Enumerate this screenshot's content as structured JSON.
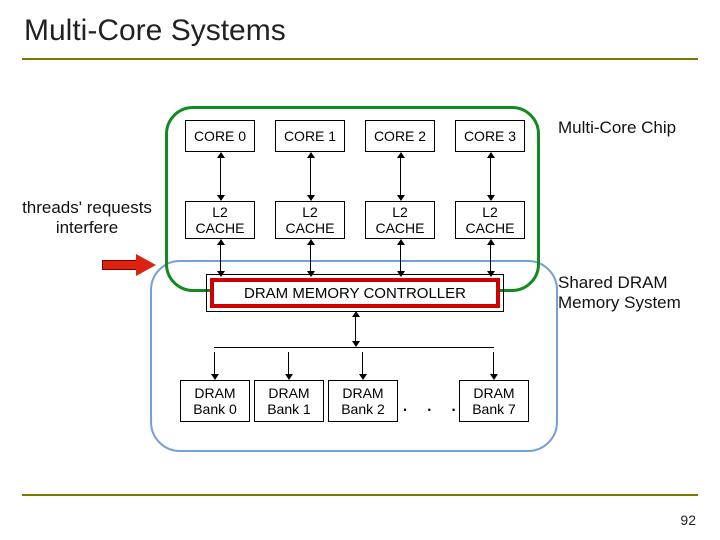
{
  "title": "Multi-Core Systems",
  "labels": {
    "chip": "Multi-Core Chip",
    "threads": "threads' requests interfere",
    "memsys": "Shared DRAM Memory System"
  },
  "cores": [
    "CORE 0",
    "CORE 1",
    "CORE 2",
    "CORE 3"
  ],
  "l2": [
    "L2 CACHE",
    "L2 CACHE",
    "L2 CACHE",
    "L2 CACHE"
  ],
  "memctrl": "DRAM MEMORY CONTROLLER",
  "banks": [
    "DRAM Bank 0",
    "DRAM Bank 1",
    "DRAM Bank 2",
    "DRAM Bank 7"
  ],
  "ellipsis": ". . .",
  "pagenum": "92"
}
